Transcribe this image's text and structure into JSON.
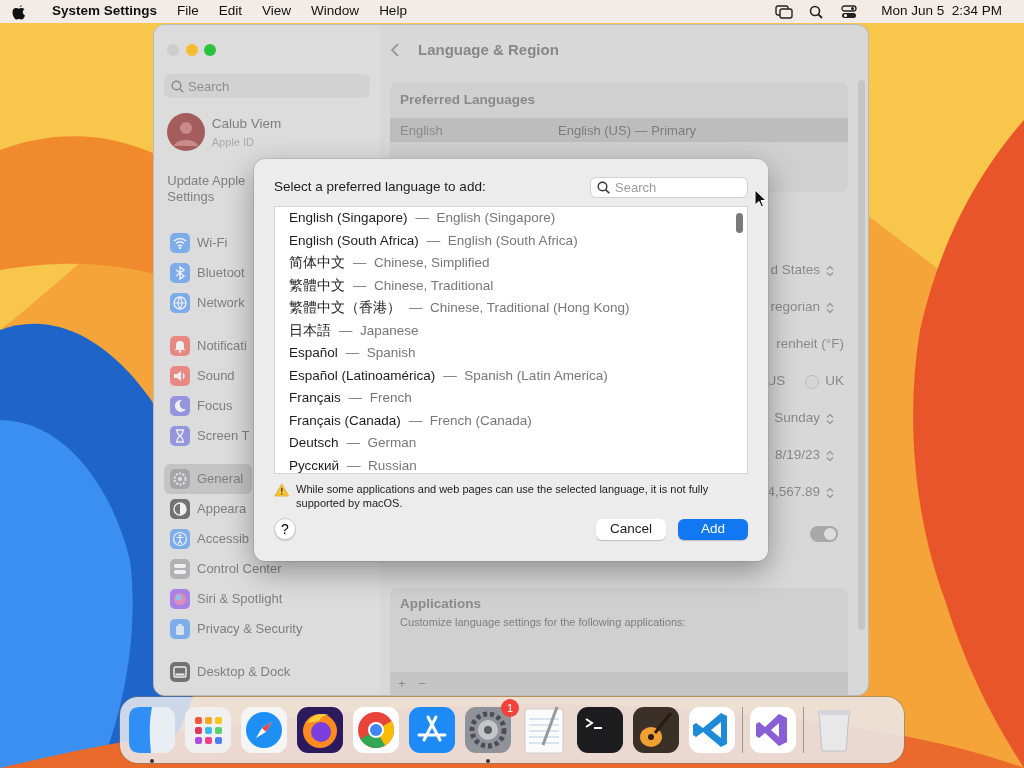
{
  "menubar": {
    "app": "System Settings",
    "menus": [
      "File",
      "Edit",
      "View",
      "Window",
      "Help"
    ],
    "clock": "Mon Jun 5  2:34 PM"
  },
  "window": {
    "title": "Language & Region",
    "sidebar": {
      "search_placeholder": "Search",
      "account": {
        "name": "Calub Viem",
        "subtitle": "Apple ID"
      },
      "notice_lines": [
        "Update Apple",
        "Settings"
      ],
      "groups": [
        [
          {
            "label": "Wi-Fi",
            "selected": false
          },
          {
            "label": "Bluetoot",
            "selected": false
          },
          {
            "label": "Network",
            "selected": false
          }
        ],
        [
          {
            "label": "Notificati",
            "selected": false
          },
          {
            "label": "Sound",
            "selected": false
          },
          {
            "label": "Focus",
            "selected": false
          },
          {
            "label": "Screen T",
            "selected": false
          }
        ],
        [
          {
            "label": "General",
            "selected": true
          },
          {
            "label": "Appeara",
            "selected": false
          },
          {
            "label": "Accessib",
            "selected": false
          },
          {
            "label": "Control Center",
            "selected": false
          },
          {
            "label": "Siri & Spotlight",
            "selected": false
          },
          {
            "label": "Privacy & Security",
            "selected": false
          }
        ],
        [
          {
            "label": "Desktop & Dock",
            "selected": false
          }
        ]
      ]
    },
    "preferred_languages": {
      "heading": "Preferred Languages",
      "rows": [
        {
          "language": "English",
          "detail": "English (US) — Primary",
          "selected": true
        }
      ]
    },
    "settings_rows": [
      {
        "kind": "popup",
        "value": "d States"
      },
      {
        "kind": "popup",
        "value": "regorian"
      },
      {
        "kind": "text",
        "value": "renheit (°F)"
      },
      {
        "kind": "radio",
        "value": "US",
        "option": {
          "label": "UK",
          "selected": false
        }
      },
      {
        "kind": "popup",
        "value": "Sunday"
      },
      {
        "kind": "popup",
        "value": "8/19/23"
      },
      {
        "kind": "popup",
        "value": "4,567.89"
      },
      {
        "kind": "toggle",
        "on": true
      }
    ],
    "applications": {
      "heading": "Applications",
      "subtitle": "Customize language settings for the following applications:",
      "add": "+",
      "remove": "−"
    }
  },
  "dialog": {
    "prompt": "Select a preferred language to add:",
    "search_placeholder": "Search",
    "languages": [
      {
        "native": "English (Singapore)",
        "dash": "—",
        "english": "English (Singapore)",
        "selected": false
      },
      {
        "native": "English (South Africa)",
        "dash": "—",
        "english": "English (South Africa)",
        "selected": false
      },
      {
        "native": "简体中文",
        "dash": "—",
        "english": "Chinese, Simplified",
        "selected": false
      },
      {
        "native": "繁體中文",
        "dash": "—",
        "english": "Chinese, Traditional",
        "selected": false
      },
      {
        "native": "繁體中文（香港）",
        "dash": "—",
        "english": "Chinese, Traditional (Hong Kong)",
        "selected": false
      },
      {
        "native": "日本語",
        "dash": "—",
        "english": "Japanese",
        "selected": false
      },
      {
        "native": "Español",
        "dash": "—",
        "english": "Spanish",
        "selected": false
      },
      {
        "native": "Español (Latinoamérica)",
        "dash": "—",
        "english": "Spanish (Latin America)",
        "selected": false
      },
      {
        "native": "Français",
        "dash": "—",
        "english": "French",
        "selected": false
      },
      {
        "native": "Français (Canada)",
        "dash": "—",
        "english": "French (Canada)",
        "selected": false
      },
      {
        "native": "Deutsch",
        "dash": "—",
        "english": "German",
        "selected": false
      },
      {
        "native": "Русский",
        "dash": "—",
        "english": "Russian",
        "selected": false
      }
    ],
    "warning": "While some applications and web pages can use the selected language, it is not fully supported by macOS.",
    "help": "?",
    "buttons": [
      {
        "label": "Cancel",
        "kind": "secondary"
      },
      {
        "label": "Add",
        "kind": "primary"
      }
    ]
  },
  "dock": {
    "items": [
      {
        "running": true
      },
      {
        "running": false
      },
      {
        "running": false
      },
      {
        "running": false
      },
      {
        "running": false
      },
      {
        "running": false
      },
      {
        "running": true,
        "badge": "1"
      },
      {
        "running": false
      },
      {
        "running": false
      },
      {
        "running": false
      },
      {
        "running": false,
        "separator_after": true
      },
      {
        "running": false,
        "separator_after": true
      },
      {
        "running": false
      }
    ]
  }
}
